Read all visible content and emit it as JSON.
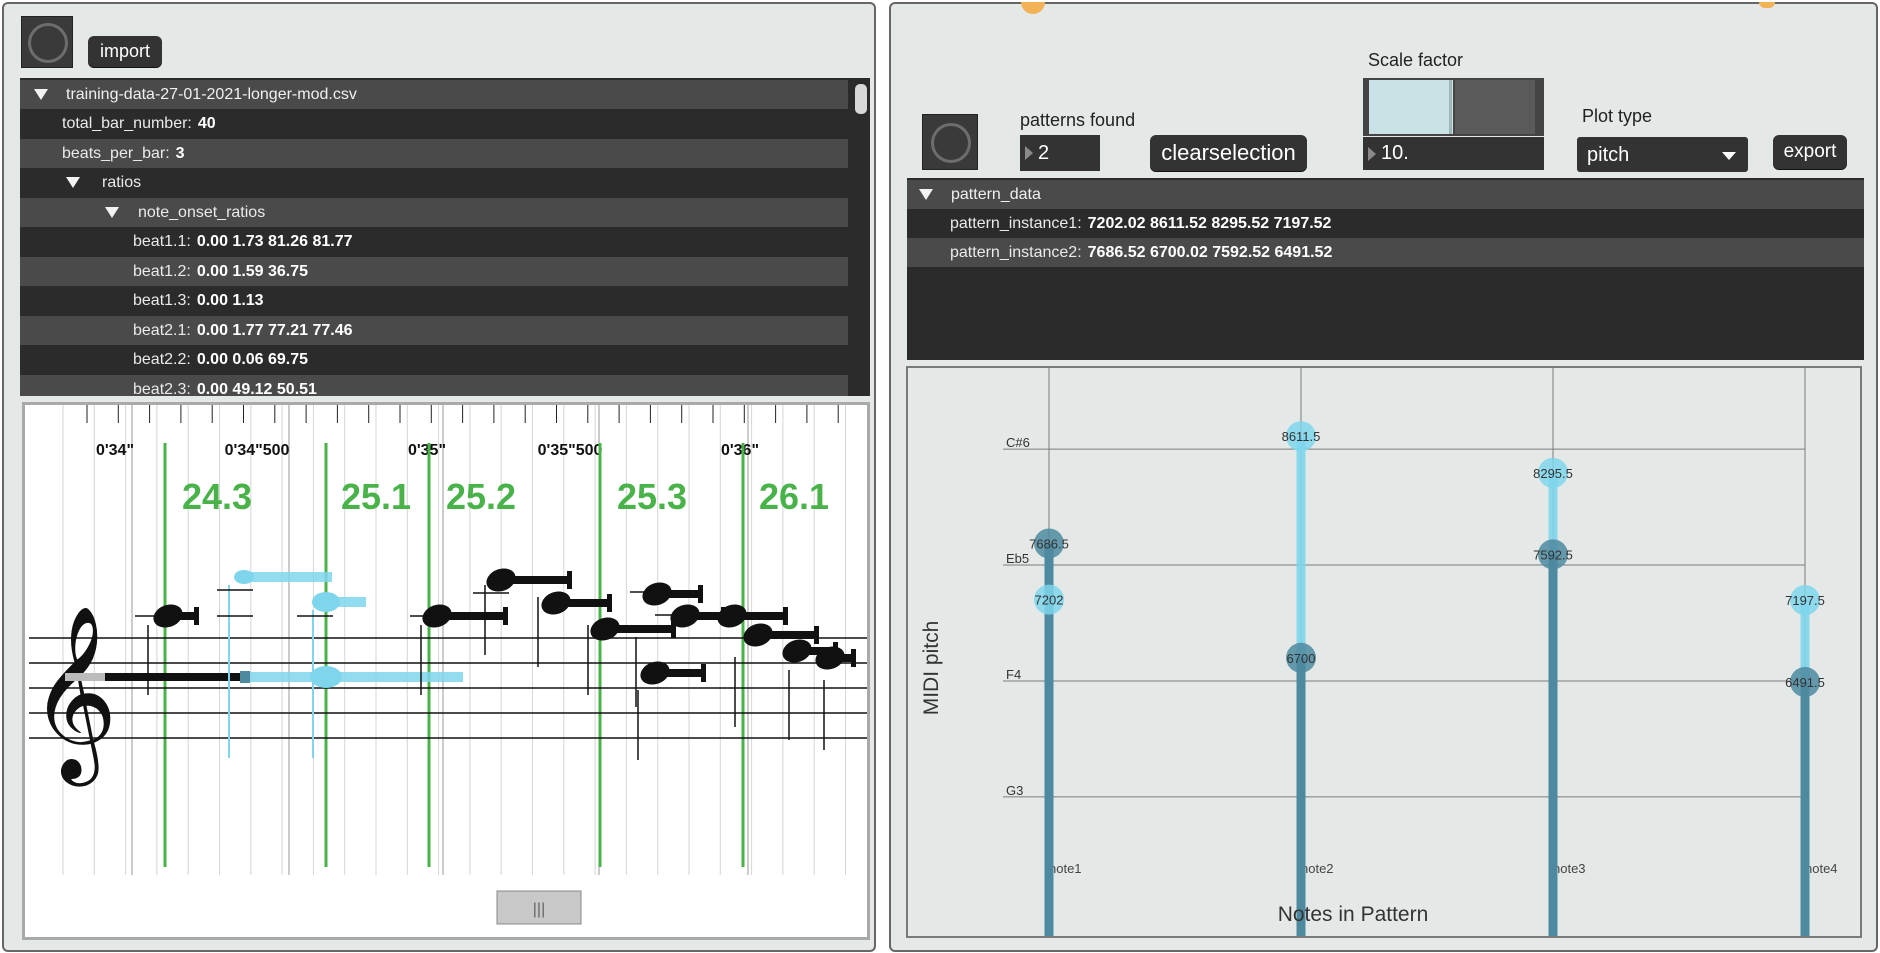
{
  "left": {
    "import_label": "import",
    "tree": {
      "root": "training-data-27-01-2021-longer-mod.csv",
      "rows": [
        {
          "key": "total_bar_number:",
          "value": "40"
        },
        {
          "key": "beats_per_bar:",
          "value": "3"
        },
        {
          "key": "ratios",
          "value": ""
        },
        {
          "key": "note_onset_ratios",
          "value": ""
        },
        {
          "key": "beat1.1:",
          "value": "0.00 1.73 81.26 81.77"
        },
        {
          "key": "beat1.2:",
          "value": "0.00 1.59 36.75"
        },
        {
          "key": "beat1.3:",
          "value": "0.00 1.13"
        },
        {
          "key": "beat2.1:",
          "value": "0.00 1.77 77.21 77.46"
        },
        {
          "key": "beat2.2:",
          "value": "0.00 0.06 69.75"
        },
        {
          "key": "beat2.3:",
          "value": "0.00 49.12 50.51"
        }
      ]
    },
    "score": {
      "time_labels": [
        "0'34\"",
        "0'34\"500",
        "0'35\"",
        "0'35\"500",
        "0'36\""
      ],
      "tempo_labels": [
        "24.3",
        "25.1",
        "25.2",
        "25.3",
        "26.1"
      ],
      "scrollbar_label": "|||"
    }
  },
  "right": {
    "patterns_found_label": "patterns found",
    "patterns_found_value": "2",
    "clearselection_label": "clearselection",
    "scale_factor_label": "Scale factor",
    "scale_factor_value": "10.",
    "scale_factor_level": 0.6,
    "plot_type_label": "Plot type",
    "plot_type_value": "pitch",
    "export_label": "export",
    "tree": {
      "root": "pattern_data",
      "rows": [
        {
          "key": "pattern_instance1:",
          "value": "7202.02 8611.52 8295.52 7197.52"
        },
        {
          "key": "pattern_instance2:",
          "value": "7686.52 6700.02 7592.52 6491.52"
        }
      ]
    }
  },
  "chart_data": {
    "type": "scatter",
    "xlabel": "Notes in Pattern",
    "ylabel": "MIDI pitch",
    "categories": [
      "note1",
      "note2",
      "note3",
      "note4"
    ],
    "ytick_labels": [
      "C#6",
      "Eb5",
      "F4",
      "G3"
    ],
    "ytick_values": [
      8500,
      7500,
      6500,
      5500
    ],
    "ylim": [
      4300,
      9200
    ],
    "series": [
      {
        "name": "pattern_instance1",
        "color": "#7fd6ec",
        "values": [
          7202,
          8611.5,
          8295.5,
          7197.5
        ]
      },
      {
        "name": "pattern_instance2",
        "color": "#4d8aa0",
        "values": [
          7686.5,
          6700,
          7592.5,
          6491.5
        ]
      }
    ],
    "grid": true
  },
  "colors": {
    "panel_bg": "#e4e9e8",
    "tree_dark": "#2b2b2b",
    "tree_alt": "#4a4a4a",
    "tempo_green": "#49b34a",
    "highlight_cyan": "#7fd6ec",
    "stem_dark": "#4d8aa0"
  }
}
